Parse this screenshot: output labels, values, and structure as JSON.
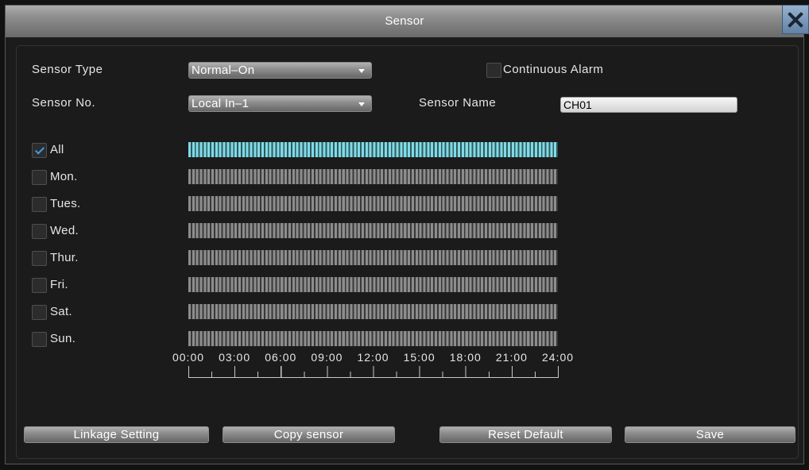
{
  "window": {
    "title": "Sensor",
    "close_icon": "close-icon"
  },
  "form": {
    "sensor_type_label": "Sensor Type",
    "sensor_type_value": "Normal–On",
    "continuous_alarm_label": "Continuous Alarm",
    "continuous_alarm_checked": false,
    "sensor_no_label": "Sensor No.",
    "sensor_no_value": "Local In–1",
    "sensor_name_label": "Sensor Name",
    "sensor_name_value": "CH01",
    "dropdown_icon": "caret-down-icon"
  },
  "schedule": {
    "days": [
      {
        "label": "All",
        "checked": true,
        "bar_selected": true
      },
      {
        "label": "Mon.",
        "checked": false,
        "bar_selected": false
      },
      {
        "label": "Tues.",
        "checked": false,
        "bar_selected": false
      },
      {
        "label": "Wed.",
        "checked": false,
        "bar_selected": false
      },
      {
        "label": "Thur.",
        "checked": false,
        "bar_selected": false
      },
      {
        "label": "Fri.",
        "checked": false,
        "bar_selected": false
      },
      {
        "label": "Sat.",
        "checked": false,
        "bar_selected": false
      },
      {
        "label": "Sun.",
        "checked": false,
        "bar_selected": false
      }
    ],
    "time_axis": [
      "00:00",
      "03:00",
      "06:00",
      "09:00",
      "12:00",
      "15:00",
      "18:00",
      "21:00",
      "24:00"
    ],
    "check_icon": "check-icon"
  },
  "buttons": {
    "linkage_setting": "Linkage Setting",
    "copy_sensor": "Copy sensor",
    "reset_default": "Reset Default",
    "save": "Save"
  },
  "colors": {
    "selected_bar": "#7fdbe7",
    "unselected_bar": "#8d8d8d",
    "check_mark": "#3f9fee",
    "close_button": "#6f94bd"
  }
}
